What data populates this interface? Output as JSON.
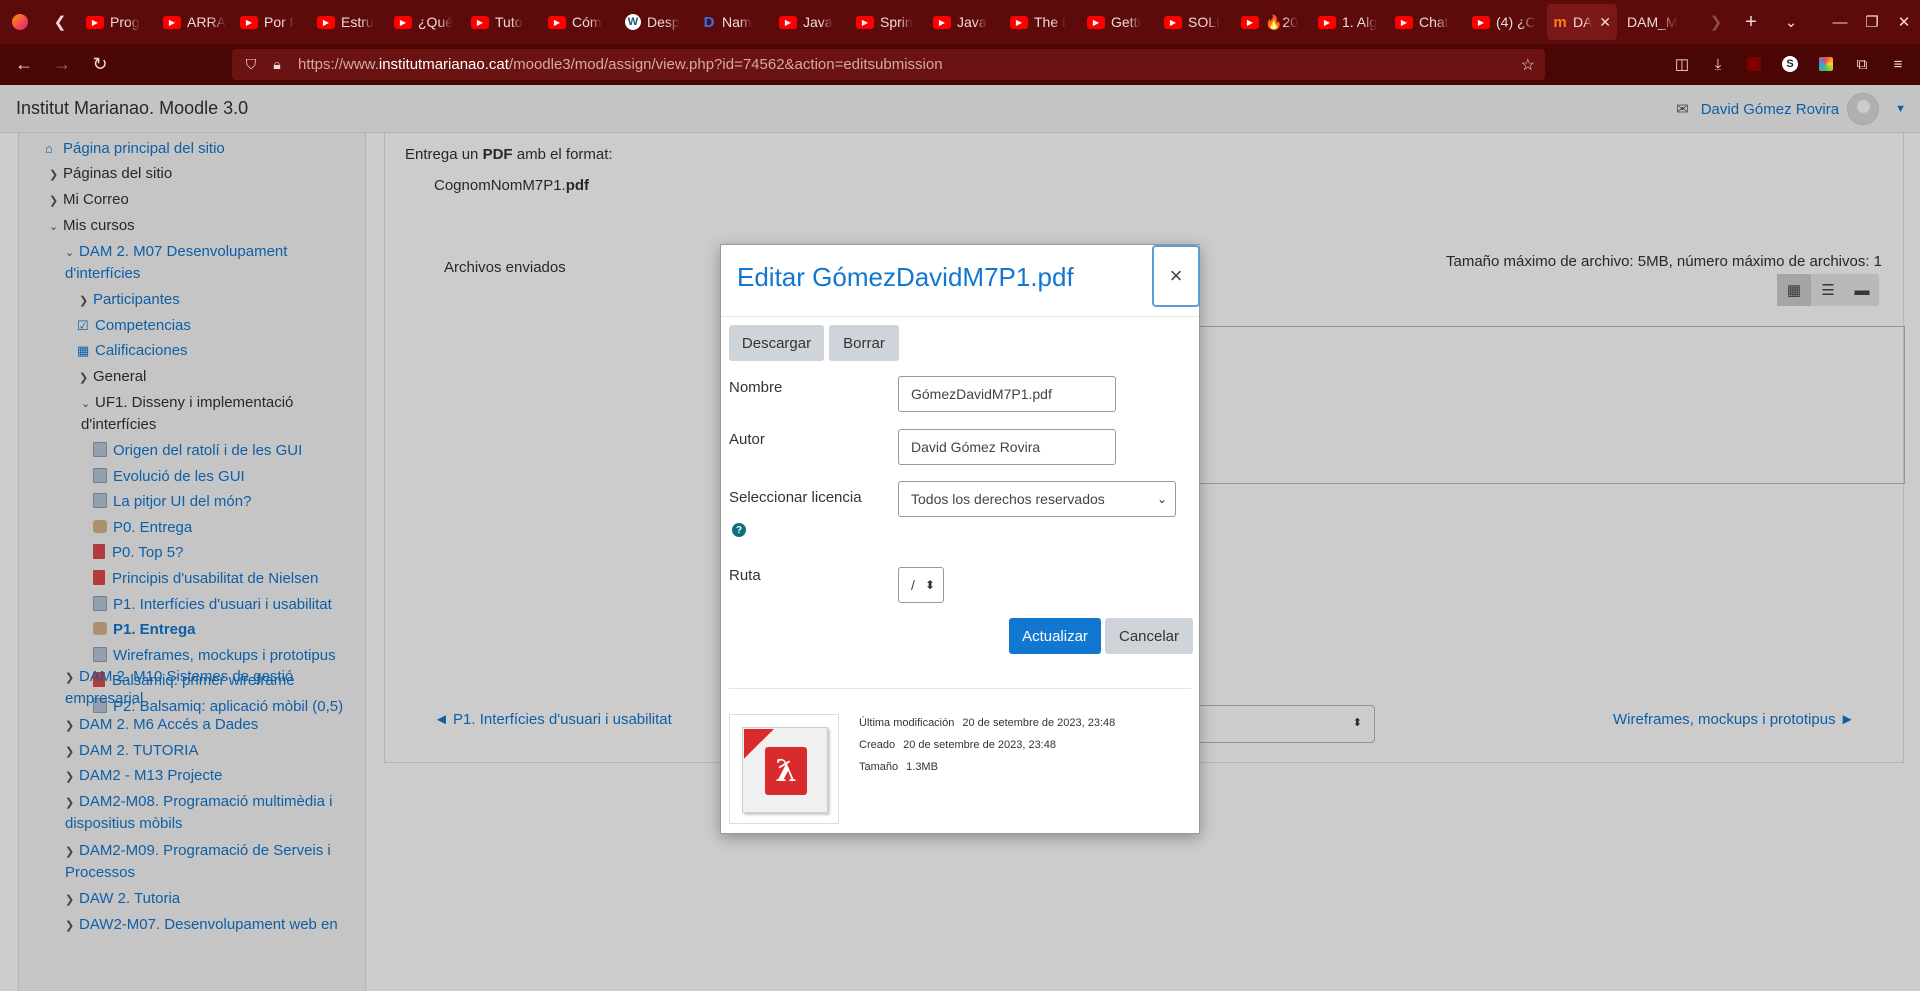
{
  "browser": {
    "tabs": [
      {
        "icon": "youtube-icon",
        "title": "Prog"
      },
      {
        "icon": "youtube-icon",
        "title": "ARRA"
      },
      {
        "icon": "youtube-icon",
        "title": "Por f"
      },
      {
        "icon": "youtube-icon",
        "title": "Estru"
      },
      {
        "icon": "youtube-icon",
        "title": "¿Qué"
      },
      {
        "icon": "youtube-icon",
        "title": "Tuto"
      },
      {
        "icon": "youtube-icon",
        "title": "Cóm"
      },
      {
        "icon": "wordpress-icon",
        "title": "Desp"
      },
      {
        "icon": "d-icon",
        "title": "Nam"
      },
      {
        "icon": "youtube-icon",
        "title": "Java"
      },
      {
        "icon": "youtube-icon",
        "title": "Sprin"
      },
      {
        "icon": "youtube-icon",
        "title": "Java"
      },
      {
        "icon": "youtube-icon",
        "title": "The I"
      },
      {
        "icon": "youtube-icon",
        "title": "Getti"
      },
      {
        "icon": "youtube-icon",
        "title": "SOLI"
      },
      {
        "icon": "youtube-icon",
        "title": "🔥20"
      },
      {
        "icon": "youtube-icon",
        "title": "1. Alg"
      },
      {
        "icon": "youtube-icon",
        "title": "Chat"
      },
      {
        "icon": "youtube-icon",
        "title": "(4) ¿C"
      }
    ],
    "active_tab": {
      "title": "DA"
    },
    "extra_tab": {
      "title": "DAM_M"
    },
    "url_prefix": "https://www.",
    "url_domain": "institutmarianao.cat",
    "url_path": "/moodle3/mod/assign/view.php?id=74562&action=editsubmission"
  },
  "header": {
    "site_name": "Institut Marianao. Moodle 3.0",
    "user_name": "David Gómez Rovira"
  },
  "sidebar": {
    "home": "Página principal del sitio",
    "pages": "Páginas del sitio",
    "mail": "Mi Correo",
    "courses": "Mis cursos",
    "course_m07_line1": "DAM 2. M07 Desenvolupament",
    "course_m07_line2": "d'interfícies",
    "participants": "Participantes",
    "competencies": "Competencias",
    "grades": "Calificaciones",
    "general": "General",
    "uf1_line1": "UF1. Disseny i implementació",
    "uf1_line2": "d'interfícies",
    "activities": [
      {
        "type": "doc",
        "label": "Origen del ratolí i de les GUI"
      },
      {
        "type": "doc",
        "label": "Evolució de les GUI"
      },
      {
        "type": "doc",
        "label": "La pitjor UI del món?"
      },
      {
        "type": "assign",
        "label": "P0. Entrega"
      },
      {
        "type": "pdf",
        "label": "P0. Top 5?"
      },
      {
        "type": "pdf",
        "label": "Principis d'usabilitat de Nielsen"
      },
      {
        "type": "doc",
        "label": "P1. Interfícies d'usuari i usabilitat"
      },
      {
        "type": "assign",
        "label": "P1. Entrega"
      },
      {
        "type": "doc",
        "label": "Wireframes, mockups i prototipus"
      },
      {
        "type": "pdf",
        "label": "Balsamiq: primer wireframe"
      },
      {
        "type": "doc",
        "label": "P2: Balsamiq: aplicació mòbil (0,5)"
      }
    ],
    "m10_line1": "DAM 2. M10 Sistemes de gestió",
    "m10_line2": "empresarial",
    "m6": "DAM 2. M6 Accés a Dades",
    "tutoria": "DAM 2. TUTORIA",
    "m13": "DAM2 - M13 Projecte",
    "m08_line1": "DAM2-M08. Programació multimèdia i",
    "m08_line2": "dispositius mòbils",
    "m09_line1": "DAM2-M09. Programació de Serveis i",
    "m09_line2": "Processos",
    "daw_tutoria": "DAW 2. Tutoria",
    "daw_m07": "DAW2-M07. Desenvolupament web en"
  },
  "main": {
    "intro_a": "Entrega un ",
    "intro_b": "PDF",
    "intro_c": " amb el format:",
    "format_a": "CognomNomM7P1.",
    "format_b": "pdf",
    "files_label": "Archivos enviados",
    "limits": "Tamaño máximo de archivo: 5MB, número máximo de archivos: 1",
    "prev_link": "◄ P1. Interfícies d'usuari i usabilitat",
    "next_link": "Wireframes, mockups i prototipus ►"
  },
  "dialog": {
    "title": "Editar GómezDavidM7P1.pdf",
    "close": "×",
    "download": "Descargar",
    "delete": "Borrar",
    "name_label": "Nombre",
    "name_value": "GómezDavidM7P1.pdf",
    "author_label": "Autor",
    "author_value": "David Gómez Rovira",
    "license_label": "Seleccionar licencia",
    "license_value": "Todos los derechos reservados",
    "path_label": "Ruta",
    "path_value": "/",
    "update": "Actualizar",
    "cancel": "Cancelar",
    "modified_label": "Última modificación",
    "modified_value": "20 de setembre de 2023, 23:48",
    "created_label": "Creado",
    "created_value": "20 de setembre de 2023, 23:48",
    "size_label": "Tamaño",
    "size_value": "1.3MB"
  },
  "colors": {
    "browser_tabbar": "#5c0a0a",
    "browser_navbar": "#4a0505",
    "link": "#1177d1",
    "primary_button": "#1177d1"
  }
}
